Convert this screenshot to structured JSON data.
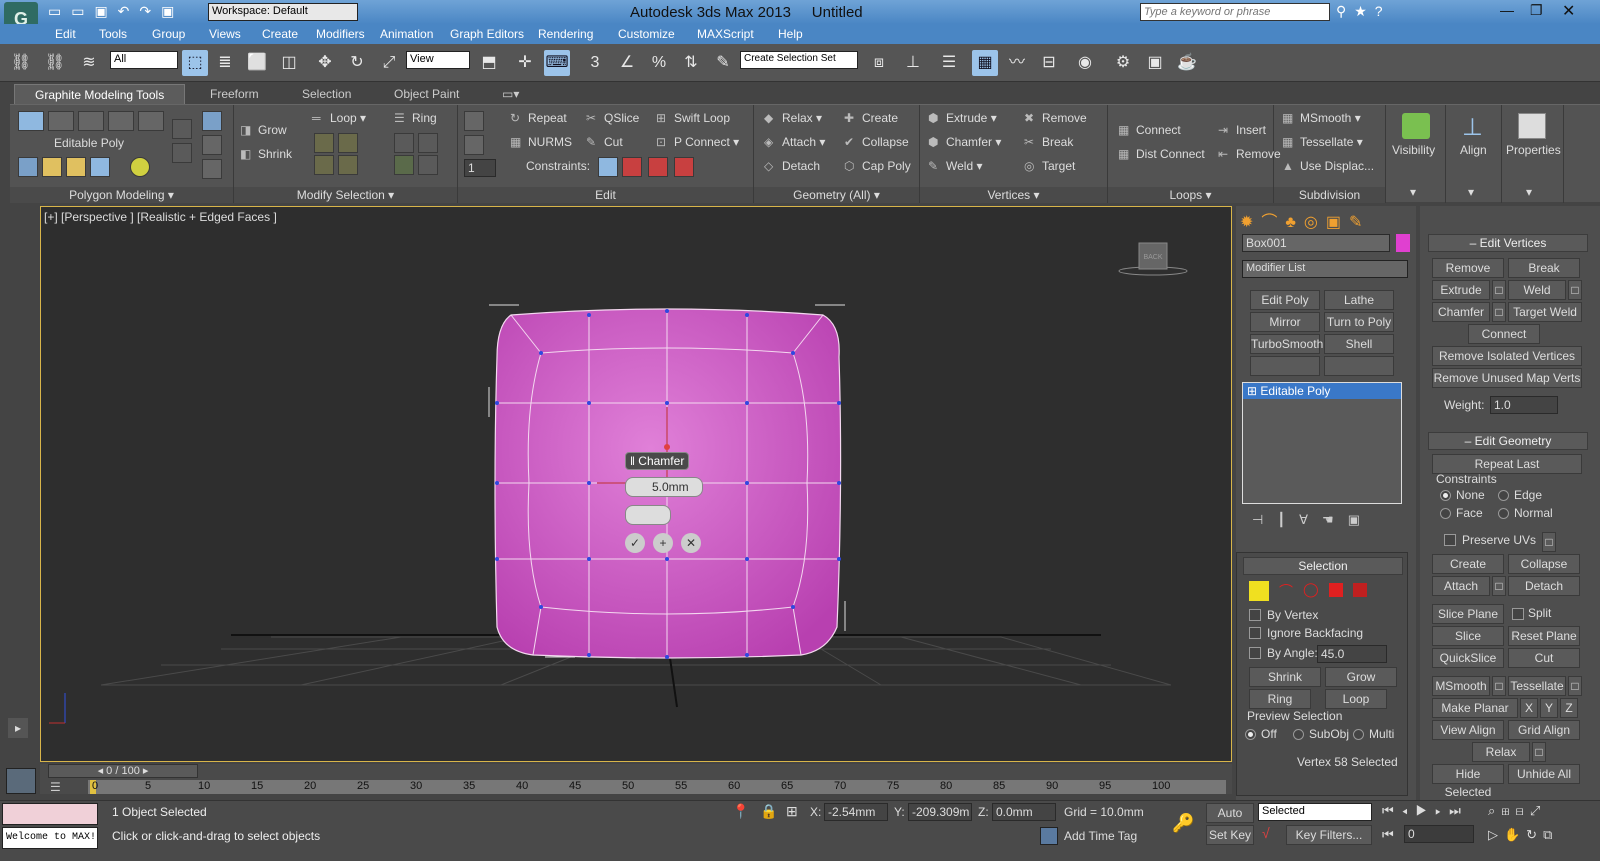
{
  "window": {
    "title": "Autodesk 3ds Max  2013",
    "doc": "Untitled",
    "workspace": "Workspace: Default",
    "search_placeholder": "Type a keyword or phrase"
  },
  "menu": [
    "Edit",
    "Tools",
    "Group",
    "Views",
    "Create",
    "Modifiers",
    "Animation",
    "Graph Editors",
    "Rendering",
    "Customize",
    "MAXScript",
    "Help"
  ],
  "toolbar": {
    "filter": "All",
    "refcoord": "View",
    "selset": "Create Selection Set"
  },
  "ribbon_tabs": [
    "Graphite Modeling Tools",
    "Freeform",
    "Selection",
    "Object Paint"
  ],
  "ribbon": {
    "polymodel": {
      "title": "Editable Poly",
      "label": "Polygon Modeling"
    },
    "modsel": {
      "grow": "Grow",
      "shrink": "Shrink",
      "loop": "Loop",
      "ring": "Ring",
      "label": "Modify Selection"
    },
    "edit": {
      "repeat": "Repeat",
      "qslice": "QSlice",
      "swift": "Swift Loop",
      "nurms": "NURMS",
      "cut": "Cut",
      "pconnect": "P Connect",
      "constraints": "Constraints:",
      "count": "1",
      "label": "Edit"
    },
    "geom": {
      "relax": "Relax",
      "create": "Create",
      "attach": "Attach",
      "collapse": "Collapse",
      "detach": "Detach",
      "cappoly": "Cap Poly",
      "label": "Geometry (All)"
    },
    "verts": {
      "extrude": "Extrude",
      "remove": "Remove",
      "chamfer": "Chamfer",
      "break": "Break",
      "weld": "Weld",
      "target": "Target",
      "label": "Vertices"
    },
    "loops": {
      "connect": "Connect",
      "insert": "Insert",
      "distconnect": "Dist Connect",
      "remove": "Remove",
      "label": "Loops"
    },
    "subdiv": {
      "msmooth": "MSmooth",
      "tessellate": "Tessellate",
      "usedisp": "Use Displac...",
      "label": "Subdivision"
    },
    "visibility": "Visibility",
    "align": "Align",
    "properties": "Properties"
  },
  "viewport": {
    "label": "[+] [Perspective ] [Realistic + Edged Faces ]",
    "cube_label": "BACK",
    "caddy_title": "Chamfer",
    "caddy_value": "5.0mm"
  },
  "command_panel": {
    "object_name": "Box001",
    "modifier_list": "Modifier List",
    "mod_buttons": [
      "Edit Poly",
      "Lathe",
      "Mirror",
      "Turn to Poly",
      "TurboSmooth",
      "Shell",
      "",
      ""
    ],
    "stack_item": "Editable Poly",
    "selection": {
      "title": "Selection",
      "by_vertex": "By Vertex",
      "ignore_backfacing": "Ignore Backfacing",
      "by_angle": "By Angle:",
      "angle": "45.0",
      "shrink": "Shrink",
      "grow": "Grow",
      "ring": "Ring",
      "loop": "Loop",
      "preview": "Preview Selection",
      "off": "Off",
      "subobj": "SubObj",
      "multi": "Multi",
      "status": "Vertex 58 Selected"
    }
  },
  "rollout": {
    "edit_vertices": {
      "title": "Edit Vertices",
      "remove": "Remove",
      "break": "Break",
      "extrude": "Extrude",
      "weld": "Weld",
      "chamfer": "Chamfer",
      "target_weld": "Target Weld",
      "connect": "Connect",
      "remove_isolated": "Remove Isolated Vertices",
      "remove_unused": "Remove Unused Map Verts",
      "weight_label": "Weight:",
      "weight": "1.0"
    },
    "edit_geometry": {
      "title": "Edit Geometry",
      "repeat_last": "Repeat Last",
      "constraints": "Constraints",
      "none": "None",
      "edge": "Edge",
      "face": "Face",
      "normal": "Normal",
      "preserve_uvs": "Preserve UVs",
      "create": "Create",
      "collapse": "Collapse",
      "attach": "Attach",
      "detach": "Detach",
      "slice_plane": "Slice Plane",
      "split": "Split",
      "slice": "Slice",
      "reset_plane": "Reset Plane",
      "quickslice": "QuickSlice",
      "cut": "Cut",
      "msmooth": "MSmooth",
      "tessellate": "Tessellate",
      "make_planar": "Make Planar",
      "x": "X",
      "y": "Y",
      "z": "Z",
      "view_align": "View Align",
      "grid_align": "Grid Align",
      "relax": "Relax",
      "hide_selected": "Hide Selected",
      "unhide_all": "Unhide All"
    }
  },
  "timeline": {
    "frame": "0 / 100",
    "ticks": [
      "0",
      "5",
      "10",
      "15",
      "20",
      "25",
      "30",
      "35",
      "40",
      "45",
      "50",
      "55",
      "60",
      "65",
      "70",
      "75",
      "80",
      "85",
      "90",
      "95",
      "100"
    ]
  },
  "status": {
    "maxscript": "Welcome to MAX!",
    "objects": "1 Object Selected",
    "prompt": "Click or click-and-drag to select objects",
    "x_label": "X:",
    "x": "-2.54mm",
    "y_label": "Y:",
    "y": "-209.309m",
    "z_label": "Z:",
    "z": "0.0mm",
    "grid": "Grid = 10.0mm",
    "add_time_tag": "Add Time Tag",
    "auto_key": "Auto Key",
    "set_key": "Set Key",
    "selected": "Selected",
    "key_filters": "Key Filters...",
    "frame": "0"
  }
}
